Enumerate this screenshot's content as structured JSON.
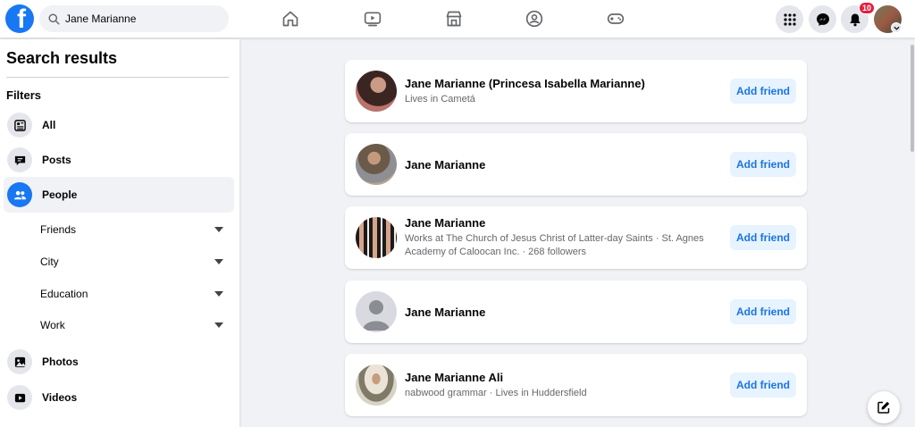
{
  "header": {
    "logo_letter": "f",
    "search_value": "Jane Marianne",
    "notifications_count": "10"
  },
  "sidebar": {
    "title": "Search results",
    "filters_heading": "Filters",
    "items": [
      {
        "label": "All",
        "icon": "feed-icon"
      },
      {
        "label": "Posts",
        "icon": "chat-bubble-icon"
      },
      {
        "label": "People",
        "icon": "people-icon",
        "active": true
      },
      {
        "label": "Photos",
        "icon": "photo-icon"
      },
      {
        "label": "Videos",
        "icon": "video-icon"
      }
    ],
    "people_subfilters": [
      {
        "label": "Friends"
      },
      {
        "label": "City"
      },
      {
        "label": "Education"
      },
      {
        "label": "Work"
      }
    ]
  },
  "results": [
    {
      "name": "Jane Marianne (Princesa Isabella Marianne)",
      "detail": "Lives in Cametá",
      "action": "Add friend"
    },
    {
      "name": "Jane Marianne",
      "detail": "",
      "action": "Add friend"
    },
    {
      "name": "Jane Marianne",
      "detail": "Works at The Church of Jesus Christ of Latter-day Saints · St. Agnes Academy of Caloocan Inc. · 268 followers",
      "action": "Add friend"
    },
    {
      "name": "Jane Marianne",
      "detail": "",
      "action": "Add friend"
    },
    {
      "name": "Jane Marianne Ali",
      "detail": "nabwood grammar · Lives in Huddersfield",
      "action": "Add friend"
    }
  ],
  "colors": {
    "brand": "#1877f2",
    "add_button_bg": "#e7f3ff",
    "add_button_text": "#1b74e4",
    "badge": "#e41e3f"
  }
}
